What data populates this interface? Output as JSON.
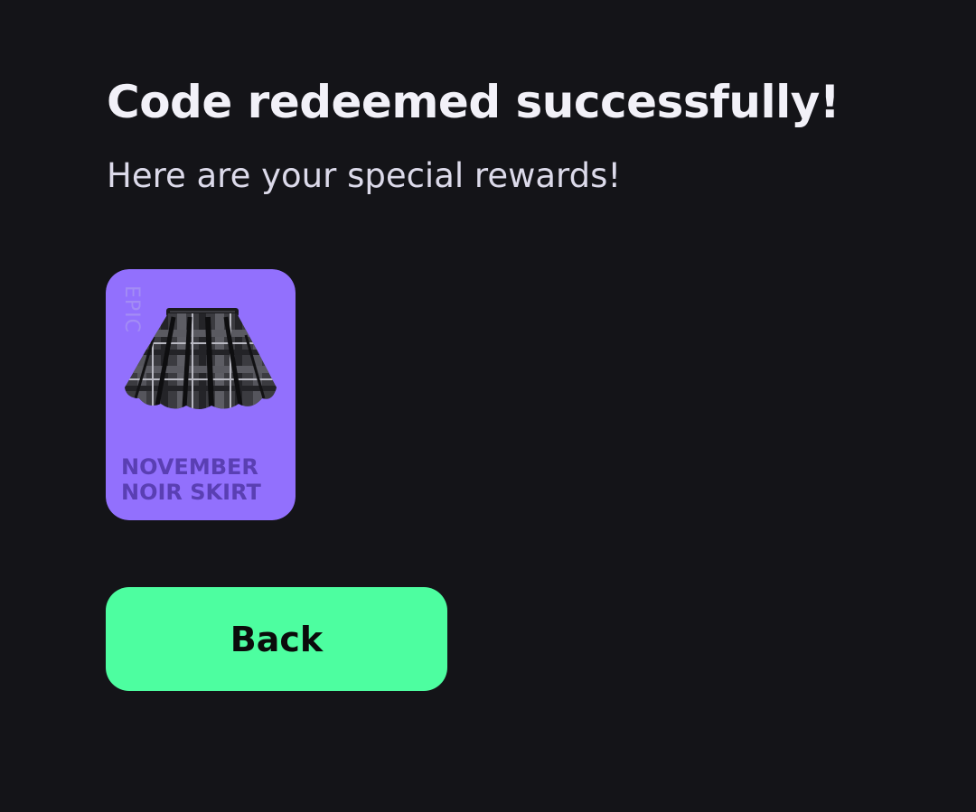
{
  "header": {
    "title": "Code redeemed successfully!",
    "subtitle": "Here are your special rewards!"
  },
  "rewards": [
    {
      "rarity": "EPIC",
      "name_line1": "NOVEMBER",
      "name_line2": "NOIR SKIRT",
      "icon": "plaid-skirt-icon",
      "card_color": "#9270fd"
    }
  ],
  "actions": {
    "back_label": "Back"
  },
  "colors": {
    "background": "#141418",
    "accent": "#4dfea0",
    "rarity_epic": "#9270fd"
  }
}
